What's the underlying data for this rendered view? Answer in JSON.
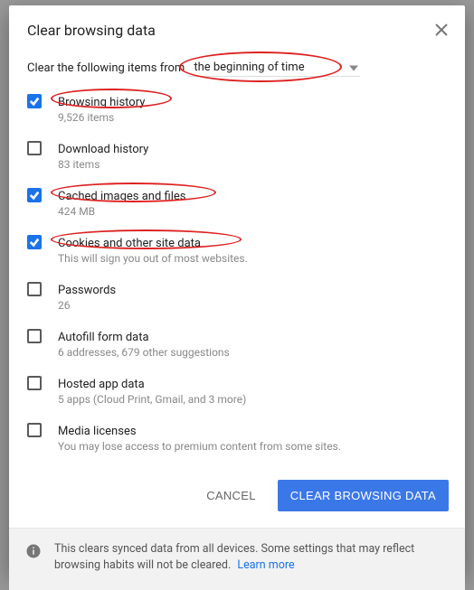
{
  "dialog": {
    "title": "Clear browsing data",
    "prompt_prefix": "Clear the following items from",
    "time_range_value": "the beginning of time"
  },
  "options": [
    {
      "key": "browsing-history",
      "checked": true,
      "label": "Browsing history",
      "sub": "9,526 items"
    },
    {
      "key": "download-history",
      "checked": false,
      "label": "Download history",
      "sub": "83 items"
    },
    {
      "key": "cached",
      "checked": true,
      "label": "Cached images and files",
      "sub": "424 MB"
    },
    {
      "key": "cookies",
      "checked": true,
      "label": "Cookies and other site data",
      "sub": "This will sign you out of most websites."
    },
    {
      "key": "passwords",
      "checked": false,
      "label": "Passwords",
      "sub": "26"
    },
    {
      "key": "autofill",
      "checked": false,
      "label": "Autofill form data",
      "sub": "6 addresses, 679 other suggestions"
    },
    {
      "key": "hosted-apps",
      "checked": false,
      "label": "Hosted app data",
      "sub": "5 apps (Cloud Print, Gmail, and 3 more)"
    },
    {
      "key": "media-licenses",
      "checked": false,
      "label": "Media licenses",
      "sub": "You may lose access to premium content from some sites."
    }
  ],
  "buttons": {
    "cancel": "CANCEL",
    "confirm": "CLEAR BROWSING DATA"
  },
  "footer": {
    "text": "This clears synced data from all devices. Some settings that may reflect browsing habits will not be cleared.",
    "learn_more": "Learn more"
  },
  "annotations": {
    "color": "#d22",
    "circled": [
      "time_range_value",
      "options.0.label",
      "options.2.label",
      "options.3.label"
    ]
  }
}
